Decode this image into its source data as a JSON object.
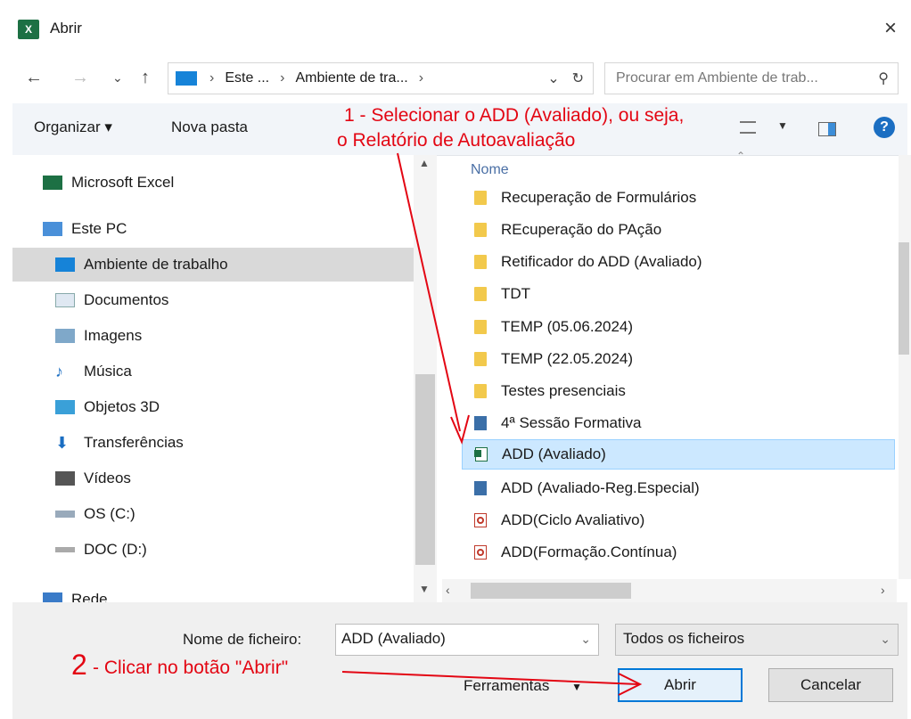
{
  "window": {
    "title": "Abrir",
    "app_icon": "excel-icon",
    "close": "×"
  },
  "nav": {
    "breadcrumb": [
      "Este ...",
      "Ambiente de tra..."
    ],
    "search_placeholder": "Procurar em Ambiente de trab..."
  },
  "toolbar": {
    "organize": "Organizar ▾",
    "new_folder": "Nova pasta",
    "help": "?"
  },
  "left_nav": {
    "items": [
      {
        "label": "Microsoft Excel",
        "icon": "excel-icon"
      },
      {
        "label": "Este PC",
        "icon": "computer-icon"
      },
      {
        "label": "Ambiente de trabalho",
        "icon": "desktop-icon",
        "selected": true
      },
      {
        "label": "Documentos",
        "icon": "documents-icon"
      },
      {
        "label": "Imagens",
        "icon": "pictures-icon"
      },
      {
        "label": "Música",
        "icon": "music-icon"
      },
      {
        "label": "Objetos 3D",
        "icon": "3d-objects-icon"
      },
      {
        "label": "Transferências",
        "icon": "downloads-icon"
      },
      {
        "label": "Vídeos",
        "icon": "videos-icon"
      },
      {
        "label": "OS (C:)",
        "icon": "drive-icon"
      },
      {
        "label": "DOC (D:)",
        "icon": "drive-icon"
      },
      {
        "label": "Rede",
        "icon": "network-icon"
      }
    ]
  },
  "file_list": {
    "column_header": "Nome",
    "files": [
      {
        "name": "Recuperação de Formulários",
        "type": "folder"
      },
      {
        "name": "REcuperação do PAção",
        "type": "folder"
      },
      {
        "name": "Retificador do ADD (Avaliado)",
        "type": "folder"
      },
      {
        "name": "TDT",
        "type": "folder"
      },
      {
        "name": "TEMP (05.06.2024)",
        "type": "folder"
      },
      {
        "name": "TEMP (22.05.2024)",
        "type": "folder"
      },
      {
        "name": "Testes presenciais",
        "type": "folder"
      },
      {
        "name": "4ª Sessão Formativa",
        "type": "shortcut"
      },
      {
        "name": "ADD (Avaliado)",
        "type": "excel",
        "selected": true
      },
      {
        "name": "ADD (Avaliado-Reg.Especial)",
        "type": "shortcut"
      },
      {
        "name": "ADD(Ciclo Avaliativo)",
        "type": "pdf"
      },
      {
        "name": "ADD(Formação.Contínua)",
        "type": "pdf"
      }
    ]
  },
  "bottom": {
    "filename_label": "Nome de ficheiro:",
    "filename_value": "ADD (Avaliado)",
    "file_type": "Todos os ficheiros",
    "tools": "Ferramentas",
    "open": "Abrir",
    "cancel": "Cancelar"
  },
  "annotations": {
    "step1_line1": "1 - Selecionar o ADD (Avaliado), ou seja,",
    "step1_line2": "o Relatório de Autoavaliação",
    "step2_number": "2",
    "step2_text": "- Clicar no botão \"Abrir\""
  },
  "colors": {
    "accent": "#0078d7",
    "annotation": "#e30613",
    "selected_row": "#cce8ff"
  }
}
